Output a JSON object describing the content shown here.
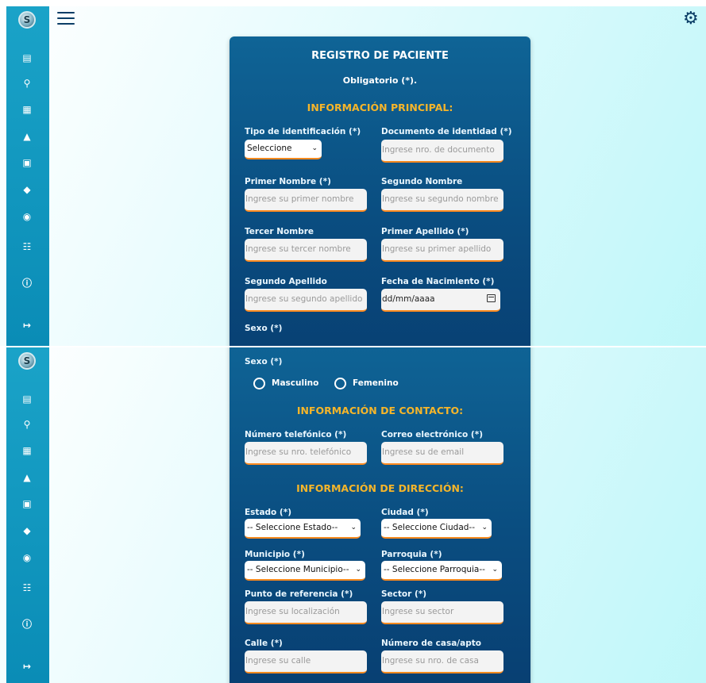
{
  "form": {
    "title": "REGISTRO DE PACIENTE",
    "required_note": "Obligatorio (*).",
    "sections": {
      "principal": "INFORMACIÓN PRINCIPAL:",
      "contacto": "INFORMACIÓN DE CONTACTO:",
      "direccion": "INFORMACIÓN DE DIRECCIÓN:"
    },
    "labels": {
      "tipo_id": "Tipo de identificación (*)",
      "documento": "Documento de identidad (*)",
      "primer_nombre": "Primer Nombre (*)",
      "segundo_nombre": "Segundo Nombre",
      "tercer_nombre": "Tercer Nombre",
      "primer_apellido": "Primer Apellido (*)",
      "segundo_apellido": "Segundo Apellido",
      "fecha_nacimiento": "Fecha de Nacimiento (*)",
      "sexo": "Sexo (*)",
      "telefono": "Número telefónico (*)",
      "correo": "Correo electrónico (*)",
      "estado": "Estado (*)",
      "ciudad": "Ciudad (*)",
      "municipio": "Municipio (*)",
      "parroquia": "Parroquia (*)",
      "punto_referencia": "Punto de referencia (*)",
      "sector": "Sector (*)",
      "calle": "Calle (*)",
      "casa": "Número de casa/apto"
    },
    "placeholders": {
      "documento": "Ingrese nro. de documento",
      "primer_nombre": "Ingrese su primer nombre",
      "segundo_nombre": "Ingrese su segundo nombre",
      "tercer_nombre": "Ingrese su tercer nombre",
      "primer_apellido": "Ingrese su primer apellido",
      "segundo_apellido": "Ingrese su segundo apellido",
      "fecha_nacimiento": "dd/mm/aaaa",
      "telefono": "Ingrese su nro. telefónico",
      "correo": "Ingrese su de email",
      "punto_referencia": "Ingrese su localización",
      "sector": "Ingrese su sector",
      "calle": "Ingrese su calle",
      "casa": "Ingrese su nro. de casa"
    },
    "selects": {
      "tipo_id": "Seleccione",
      "estado": "-- Seleccione Estado--",
      "ciudad": "-- Seleccione Ciudad--",
      "municipio": "-- Seleccione Municipio--",
      "parroquia": "-- Seleccione Parroquia--"
    },
    "sexo_options": [
      "Masculino",
      "Femenino"
    ]
  },
  "icons": {
    "menu": "hamburger-menu-icon",
    "settings": "gear-icon",
    "sidebar": [
      "patient-record-icon",
      "microscope-icon",
      "file-medical-icon",
      "flask-icon",
      "clipboard-icon",
      "box-icon",
      "eye-icon",
      "users-icon",
      "info-icon",
      "logout-icon"
    ]
  },
  "colors": {
    "sidebar": "#0a8cb6",
    "card": "#0a4d80",
    "accent": "#f5b52a",
    "field_underline": "#ff8a1e"
  }
}
